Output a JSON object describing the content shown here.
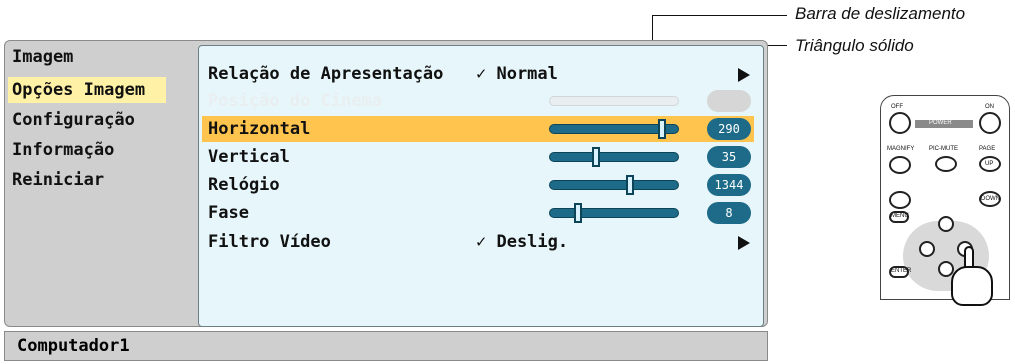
{
  "left_menu": {
    "items": [
      {
        "label": "Imagem"
      },
      {
        "label": "Opções Imagem"
      },
      {
        "label": "Configuração"
      },
      {
        "label": "Informação"
      },
      {
        "label": "Reiniciar"
      }
    ]
  },
  "content": {
    "rows": [
      {
        "label": "Relação de Apresentação",
        "value": "✓ Normal"
      },
      {
        "label": "Posição do Cinema"
      },
      {
        "label": "Horizontal",
        "number": "290",
        "level": 0.9
      },
      {
        "label": "Vertical",
        "number": "35",
        "level": 0.35
      },
      {
        "label": "Relógio",
        "number": "1344",
        "level": 0.63
      },
      {
        "label": "Fase",
        "number": "8",
        "level": 0.2
      },
      {
        "label": "Filtro Vídeo",
        "value": "✓ Deslig."
      }
    ]
  },
  "status": {
    "text": "Computador1"
  },
  "callouts": {
    "slider_bar": "Barra de deslizamento",
    "solid_triangle": "Triângulo sólido"
  },
  "remote": {
    "off": "OFF",
    "on": "ON",
    "power": "POWER",
    "magnify": "MAGNIFY",
    "pic_mute": "PIC-MUTE",
    "page": "PAGE",
    "up": "UP",
    "down": "DOWN",
    "menu": "MENU",
    "enter": "ENTER"
  },
  "colors": {
    "selected_menu": "#fff2a6",
    "highlight_row": "#ffc44d",
    "slider": "#1d6b89",
    "content_bg": "#e6f6fa"
  }
}
